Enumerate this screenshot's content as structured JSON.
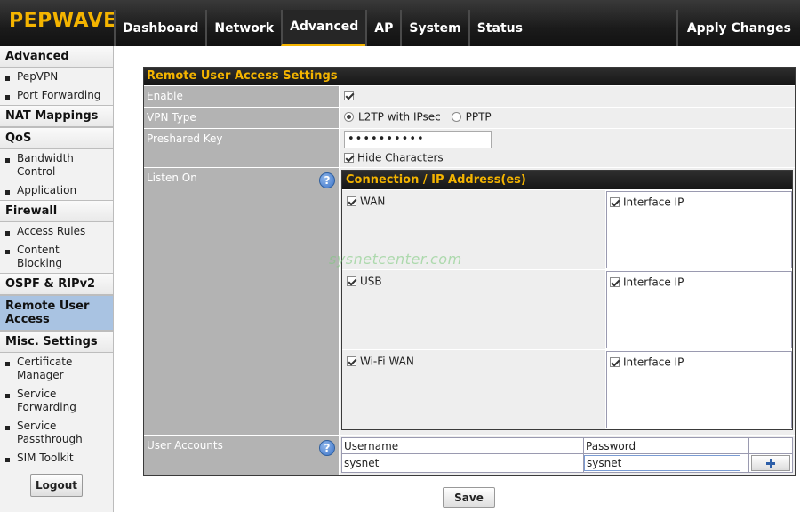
{
  "brand": {
    "logo": "PEPWAVE",
    "accent": "#f4b400"
  },
  "nav": {
    "tabs": [
      {
        "label": "Dashboard"
      },
      {
        "label": "Network"
      },
      {
        "label": "Advanced"
      },
      {
        "label": "AP"
      },
      {
        "label": "System"
      },
      {
        "label": "Status"
      }
    ],
    "active_tab": "Advanced",
    "apply_changes": "Apply Changes"
  },
  "sidebar": {
    "sections": [
      {
        "title": "Advanced",
        "items": [
          "PepVPN",
          "Port Forwarding"
        ]
      },
      {
        "title": "NAT Mappings",
        "items": []
      },
      {
        "title": "QoS",
        "items": [
          "Bandwidth Control",
          "Application"
        ]
      },
      {
        "title": "Firewall",
        "items": [
          "Access Rules",
          "Content Blocking"
        ]
      },
      {
        "title": "OSPF & RIPv2",
        "items": []
      },
      {
        "title": "Remote User Access",
        "items": []
      },
      {
        "title": "Misc. Settings",
        "items": [
          "Certificate Manager",
          "Service Forwarding",
          "Service Passthrough",
          "SIM Toolkit"
        ]
      }
    ],
    "active_section": "Remote User Access",
    "logout": "Logout"
  },
  "form": {
    "title": "Remote User Access Settings",
    "enable": {
      "label": "Enable",
      "checked": true
    },
    "vpn_type": {
      "label": "VPN Type",
      "options": [
        "L2TP with IPsec",
        "PPTP"
      ],
      "selected": "L2TP with IPsec"
    },
    "preshared_key": {
      "label": "Preshared Key",
      "value": "••••••••••",
      "hide_characters": "Hide Characters",
      "hide_checked": true
    },
    "listen_on": {
      "label": "Listen On",
      "help": "?",
      "table_title": "Connection / IP Address(es)",
      "rows": [
        {
          "connection": "WAN",
          "ip": "Interface IP"
        },
        {
          "connection": "USB",
          "ip": "Interface IP"
        },
        {
          "connection": "Wi-Fi WAN",
          "ip": "Interface IP"
        }
      ]
    },
    "user_accounts": {
      "label": "User Accounts",
      "help": "?",
      "col_username": "Username",
      "col_password": "Password",
      "row": {
        "username": "sysnet",
        "password": "sysnet"
      }
    },
    "save": "Save"
  },
  "watermark": "sysnetcenter.com"
}
